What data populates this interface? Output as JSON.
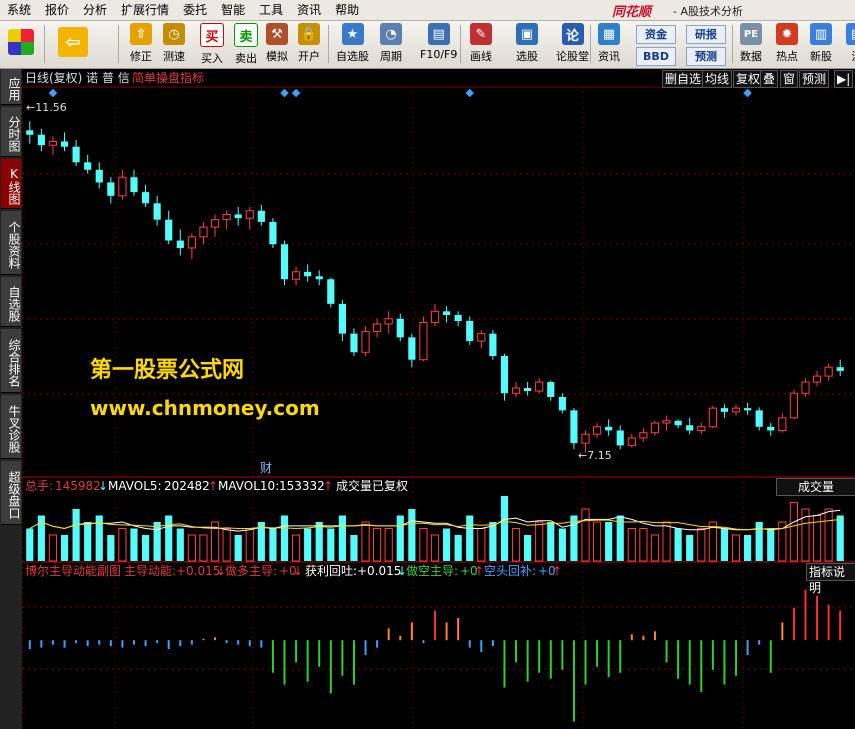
{
  "menu": [
    "系统",
    "报价",
    "分析",
    "扩展行情",
    "委托",
    "智能",
    "工具",
    "资讯",
    "帮助"
  ],
  "brand": "同花顺",
  "brand_sub": "- A股技术分析",
  "toolbar": {
    "buttons": [
      {
        "label": "修正",
        "icon": "up-arrow-icon"
      },
      {
        "label": "测速",
        "icon": "clock-icon"
      },
      {
        "label": "买入",
        "icon": "buy-icon",
        "glyph": "买"
      },
      {
        "label": "卖出",
        "icon": "sell-icon",
        "glyph": "卖"
      },
      {
        "label": "模拟",
        "icon": "hammer-icon"
      },
      {
        "label": "开户",
        "icon": "lock-icon"
      },
      {
        "label": "自选股",
        "icon": "star-icon"
      },
      {
        "label": "周期",
        "icon": "period-icon"
      },
      {
        "label": "F10/F9",
        "icon": "f10-icon"
      },
      {
        "label": "画线",
        "icon": "pen-icon"
      },
      {
        "label": "选股",
        "icon": "screen-icon"
      },
      {
        "label": "论股堂",
        "icon": "forum-icon",
        "glyph": "论"
      },
      {
        "label": "资讯",
        "icon": "news-icon"
      },
      {
        "label": "数据",
        "icon": "pe-icon",
        "glyph": "PE"
      },
      {
        "label": "热点",
        "icon": "hot-icon"
      },
      {
        "label": "新股",
        "icon": "new-stock-icon"
      },
      {
        "label": "沪",
        "icon": "sh-icon"
      }
    ],
    "small": [
      "资金",
      "研报",
      "BBD",
      "预测"
    ]
  },
  "sidebar": [
    {
      "label": "应用"
    },
    {
      "label": "分时图"
    },
    {
      "label": "K线图"
    },
    {
      "label": "个股资料"
    },
    {
      "label": "自选股"
    },
    {
      "label": "综合排名"
    },
    {
      "label": "牛叉诊股"
    },
    {
      "label": "超级盘口"
    }
  ],
  "chart": {
    "title": "日线(复权) 诺 普 信",
    "indicator": "简单操盘指标",
    "right_tabs": [
      "删自选",
      "均线",
      "复权",
      "叠",
      "窗",
      "预测"
    ],
    "high_label": "11.56",
    "low_label": "7.15",
    "watermark1": "第一股票公式网",
    "watermark2": "www.chnmoney.com",
    "fin_mark": "财"
  },
  "volume": {
    "total_label": "总手:",
    "total": "145982",
    "mavol5_label": "MAVOL5:",
    "mavol5": "202482",
    "mavol10_label": "MAVOL10:",
    "mavol10": "153332",
    "adjusted": "成交量已复权",
    "button": "成交量"
  },
  "indicator_panel": {
    "name": "博尔主导动能副图",
    "f1_label": "主导动能:",
    "f1": "+0.015",
    "f2_label": "做多主导:",
    "f2": "+0",
    "f3_label": "获利回吐:",
    "f3": "+0.015",
    "f4_label": "做空主导:",
    "f4": "+0",
    "f5_label": "空头回补:",
    "f5": "+0",
    "button": "指标说明"
  },
  "colors": {
    "up": "#ff4040",
    "down": "#54fcfc",
    "text": "#dddddd",
    "grid": "#7a0000"
  },
  "chart_data": {
    "type": "candlestick",
    "candles": [
      [
        11.48,
        11.6,
        11.3,
        11.42
      ],
      [
        11.42,
        11.5,
        11.2,
        11.28
      ],
      [
        11.28,
        11.4,
        11.15,
        11.33
      ],
      [
        11.33,
        11.45,
        11.2,
        11.26
      ],
      [
        11.26,
        11.35,
        11.0,
        11.05
      ],
      [
        11.05,
        11.15,
        10.9,
        10.95
      ],
      [
        10.95,
        11.05,
        10.7,
        10.78
      ],
      [
        10.78,
        10.85,
        10.5,
        10.6
      ],
      [
        10.6,
        10.95,
        10.55,
        10.85
      ],
      [
        10.85,
        10.95,
        10.6,
        10.65
      ],
      [
        10.65,
        10.75,
        10.45,
        10.5
      ],
      [
        10.5,
        10.6,
        10.2,
        10.28
      ],
      [
        10.28,
        10.4,
        9.95,
        10.0
      ],
      [
        10.0,
        10.15,
        9.8,
        9.9
      ],
      [
        9.9,
        10.1,
        9.75,
        10.05
      ],
      [
        10.05,
        10.25,
        9.95,
        10.18
      ],
      [
        10.18,
        10.35,
        10.05,
        10.28
      ],
      [
        10.28,
        10.4,
        10.15,
        10.35
      ],
      [
        10.35,
        10.45,
        10.2,
        10.3
      ],
      [
        10.3,
        10.45,
        10.15,
        10.4
      ],
      [
        10.4,
        10.48,
        10.2,
        10.25
      ],
      [
        10.25,
        10.3,
        9.9,
        9.95
      ],
      [
        9.95,
        10.0,
        9.4,
        9.48
      ],
      [
        9.48,
        9.65,
        9.4,
        9.58
      ],
      [
        9.58,
        9.68,
        9.45,
        9.52
      ],
      [
        9.52,
        9.6,
        9.4,
        9.48
      ],
      [
        9.48,
        9.5,
        9.1,
        9.15
      ],
      [
        9.15,
        9.2,
        8.65,
        8.75
      ],
      [
        8.75,
        8.82,
        8.45,
        8.5
      ],
      [
        8.5,
        8.85,
        8.45,
        8.78
      ],
      [
        8.78,
        8.95,
        8.7,
        8.88
      ],
      [
        8.88,
        9.05,
        8.75,
        8.95
      ],
      [
        8.95,
        9.02,
        8.65,
        8.7
      ],
      [
        8.7,
        8.75,
        8.3,
        8.4
      ],
      [
        8.4,
        8.98,
        8.38,
        8.9
      ],
      [
        8.9,
        9.15,
        8.85,
        9.05
      ],
      [
        9.05,
        9.12,
        8.9,
        9.0
      ],
      [
        9.0,
        9.05,
        8.85,
        8.92
      ],
      [
        8.92,
        8.98,
        8.6,
        8.65
      ],
      [
        8.65,
        8.8,
        8.55,
        8.75
      ],
      [
        8.75,
        8.8,
        8.4,
        8.45
      ],
      [
        8.45,
        8.48,
        7.85,
        7.95
      ],
      [
        7.95,
        8.1,
        7.9,
        8.02
      ],
      [
        8.02,
        8.1,
        7.92,
        7.98
      ],
      [
        7.98,
        8.15,
        7.95,
        8.1
      ],
      [
        8.1,
        8.12,
        7.85,
        7.9
      ],
      [
        7.9,
        7.95,
        7.68,
        7.72
      ],
      [
        7.72,
        7.75,
        7.2,
        7.28
      ],
      [
        7.28,
        7.45,
        7.15,
        7.4
      ],
      [
        7.4,
        7.55,
        7.35,
        7.5
      ],
      [
        7.5,
        7.6,
        7.38,
        7.45
      ],
      [
        7.45,
        7.52,
        7.2,
        7.25
      ],
      [
        7.25,
        7.4,
        7.22,
        7.35
      ],
      [
        7.35,
        7.48,
        7.3,
        7.42
      ],
      [
        7.42,
        7.58,
        7.38,
        7.55
      ],
      [
        7.55,
        7.65,
        7.45,
        7.58
      ],
      [
        7.58,
        7.6,
        7.48,
        7.52
      ],
      [
        7.52,
        7.62,
        7.4,
        7.45
      ],
      [
        7.45,
        7.55,
        7.4,
        7.5
      ],
      [
        7.5,
        7.78,
        7.48,
        7.75
      ],
      [
        7.75,
        7.8,
        7.62,
        7.7
      ],
      [
        7.7,
        7.8,
        7.65,
        7.75
      ],
      [
        7.75,
        7.82,
        7.66,
        7.72
      ],
      [
        7.72,
        7.76,
        7.45,
        7.5
      ],
      [
        7.5,
        7.55,
        7.38,
        7.45
      ],
      [
        7.45,
        7.68,
        7.42,
        7.62
      ],
      [
        7.62,
        8.0,
        7.6,
        7.95
      ],
      [
        7.95,
        8.15,
        7.9,
        8.1
      ],
      [
        8.1,
        8.25,
        8.05,
        8.18
      ],
      [
        8.18,
        8.35,
        8.12,
        8.3
      ],
      [
        8.3,
        8.4,
        8.18,
        8.25
      ]
    ],
    "volume": [
      5,
      7,
      4,
      4,
      8,
      6,
      7,
      4,
      5,
      5,
      4,
      6,
      7,
      5,
      4,
      4,
      6,
      5,
      4,
      5,
      6,
      5,
      7,
      4,
      5,
      6,
      5,
      7,
      4,
      6,
      5,
      5,
      7,
      8,
      5,
      4,
      5,
      4,
      7,
      5,
      6,
      10,
      5,
      4,
      6,
      6,
      5,
      7,
      8,
      6,
      6,
      7,
      5,
      5,
      4,
      6,
      5,
      4,
      5,
      6,
      5,
      4,
      4,
      6,
      5,
      6,
      9,
      8,
      7,
      8,
      7
    ],
    "momentum": [
      -0.06,
      -0.05,
      -0.03,
      -0.05,
      -0.02,
      -0.04,
      -0.03,
      -0.04,
      -0.05,
      -0.03,
      -0.04,
      -0.02,
      -0.06,
      -0.04,
      -0.03,
      0.01,
      0.02,
      -0.02,
      -0.03,
      -0.04,
      -0.05,
      -0.22,
      -0.3,
      -0.15,
      -0.28,
      -0.18,
      -0.36,
      -0.24,
      -0.3,
      -0.1,
      -0.05,
      0.08,
      0.03,
      0.12,
      -0.02,
      0.2,
      0.12,
      0.15,
      -0.05,
      -0.08,
      -0.04,
      -0.32,
      -0.15,
      -0.28,
      -0.22,
      -0.26,
      -0.2,
      -0.55,
      -0.3,
      -0.18,
      -0.25,
      -0.22,
      0.04,
      0.03,
      0.06,
      -0.15,
      -0.26,
      -0.3,
      -0.35,
      -0.2,
      -0.3,
      -0.24,
      -0.1,
      -0.03,
      -0.22,
      0.12,
      0.22,
      0.34,
      0.3,
      0.24,
      0.2
    ],
    "price_range": [
      7.0,
      11.9
    ],
    "momentum_range": [
      -0.6,
      0.4
    ],
    "grid": true
  }
}
